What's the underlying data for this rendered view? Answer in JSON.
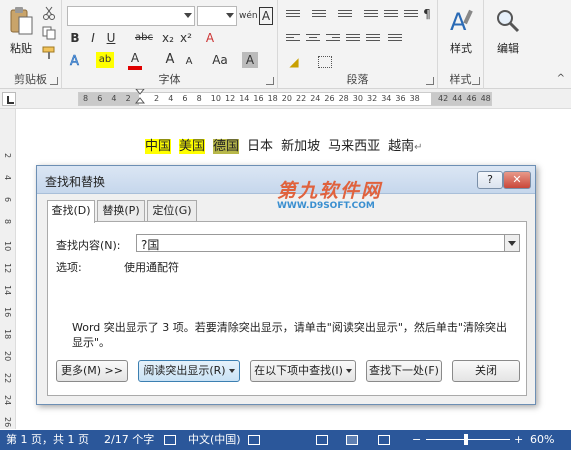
{
  "ribbon": {
    "clipboard": {
      "paste_label": "粘贴",
      "group_label": "剪贴板"
    },
    "font": {
      "group_label": "字体",
      "bold": "B",
      "italic": "I",
      "underline": "U",
      "strike": "abc",
      "subscript": "x₂",
      "superscript": "x²",
      "clear_format": "A",
      "grow": "A",
      "shrink": "A",
      "font_color": "A",
      "highlight": "ab",
      "phonetic": "wén",
      "char_border": "A"
    },
    "paragraph": {
      "group_label": "段落"
    },
    "styles": {
      "label": "样式",
      "group_label": "样式"
    },
    "editing": {
      "label": "编辑"
    }
  },
  "ruler": {
    "h_numbers": [
      "8",
      "6",
      "4",
      "2",
      "",
      "2",
      "4",
      "6",
      "8",
      "10",
      "12",
      "14",
      "16",
      "18",
      "20",
      "22",
      "24",
      "26",
      "28",
      "30",
      "32",
      "34",
      "36",
      "38",
      "",
      "42",
      "44",
      "46",
      "48"
    ],
    "v_numbers": [
      "2",
      "4",
      "6",
      "8",
      "10",
      "12",
      "14",
      "16",
      "18",
      "20",
      "22",
      "24",
      "26"
    ]
  },
  "document": {
    "words": [
      {
        "text": "中国",
        "style": "hl"
      },
      {
        "text": "美国",
        "style": "hl"
      },
      {
        "text": "德国",
        "style": "hl-sel"
      },
      {
        "text": "日本",
        "style": ""
      },
      {
        "text": "新加坡",
        "style": ""
      },
      {
        "text": "马来西亚",
        "style": ""
      },
      {
        "text": "越南",
        "style": ""
      }
    ],
    "para_mark": "↵"
  },
  "dialog": {
    "title": "查找和替换",
    "help": "?",
    "close": "✕",
    "tabs": [
      "查找(D)",
      "替换(P)",
      "定位(G)"
    ],
    "find_label": "查找内容(N):",
    "find_value": "?国",
    "options_label": "选项:",
    "options_value": "使用通配符",
    "message": "Word 突出显示了 3 项。若要清除突出显示，请单击\"阅读突出显示\"，然后单击\"清除突出显示\"。",
    "buttons": {
      "more": "更多(M) >>",
      "reading_highlight": "阅读突出显示(R)",
      "find_in": "在以下项中查找(I)",
      "find_next": "查找下一处(F)",
      "close": "关闭"
    }
  },
  "watermark": {
    "main": "第九软件网",
    "sub": "WWW.D9SOFT.COM"
  },
  "status_bar": {
    "page": "第 1 页，共 1 页",
    "words": "2/17 个字",
    "language": "中文(中国)",
    "zoom_minus": "−",
    "zoom_plus": "+",
    "zoom": "60%",
    "zoom_level_percent": 60
  }
}
